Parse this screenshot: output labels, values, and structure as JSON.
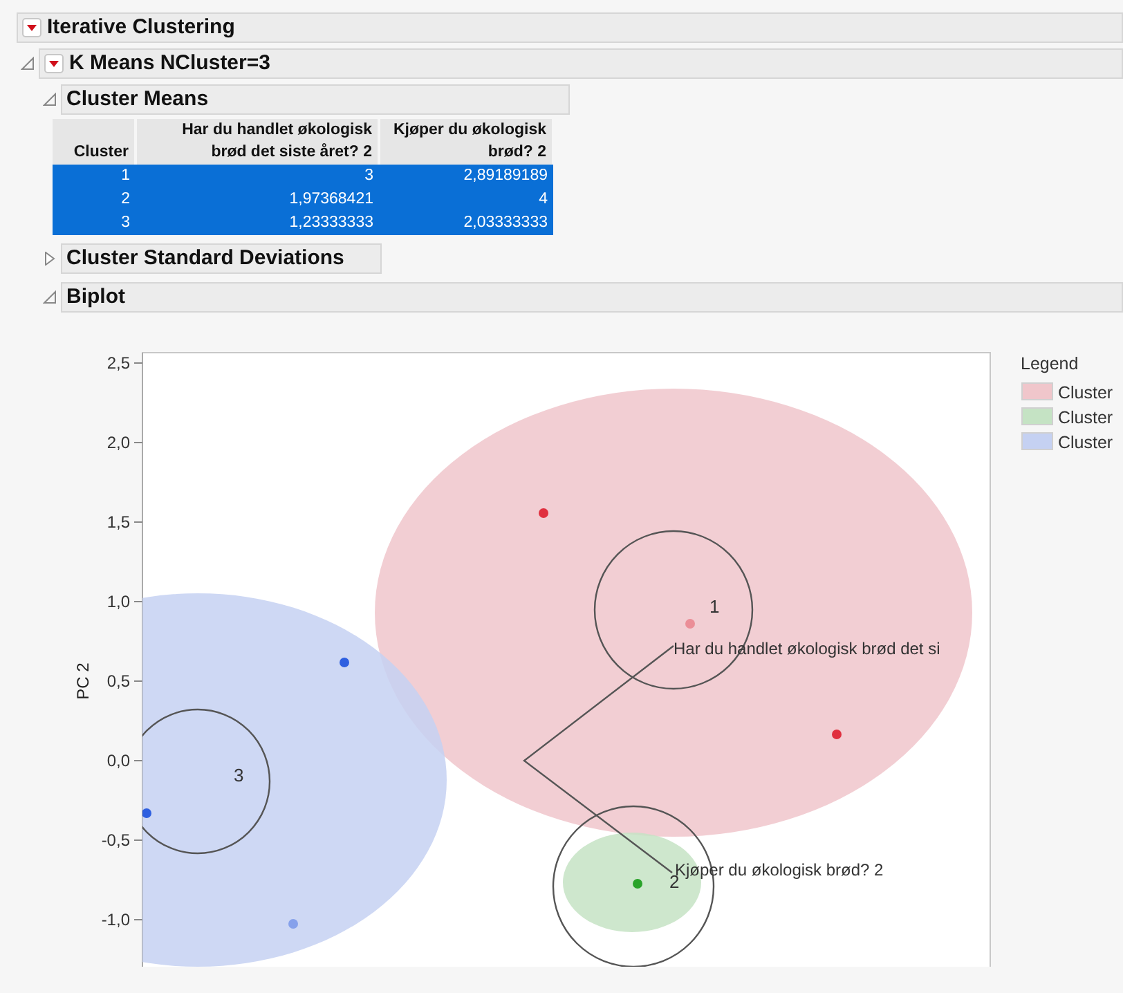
{
  "report": {
    "title": "Iterative Clustering",
    "has_menu": true
  },
  "kmeans": {
    "title": "K Means NCluster=3",
    "expanded": true,
    "has_menu": true
  },
  "cluster_means": {
    "title": "Cluster Means",
    "expanded": true,
    "columns": [
      "Cluster",
      "Har du handlet økologisk brød det siste året? 2",
      "Kjøper du økologisk brød? 2"
    ],
    "rows": [
      {
        "cells": [
          "1",
          "3",
          "2,89189189"
        ],
        "selected": true
      },
      {
        "cells": [
          "2",
          "1,97368421",
          "4"
        ],
        "selected": true
      },
      {
        "cells": [
          "3",
          "1,23333333",
          "2,03333333"
        ],
        "selected": true
      }
    ]
  },
  "cluster_sd": {
    "title": "Cluster Standard Deviations",
    "expanded": false
  },
  "biplot": {
    "title": "Biplot",
    "expanded": true,
    "plot": {
      "axis_title": "PC 2",
      "tick_labels": [
        "2,5",
        "2,0",
        "1,5",
        "1,0",
        "0,5",
        "0,0",
        "-0,5",
        "-1,0"
      ],
      "cluster_labels": [
        "1",
        "2",
        "3"
      ],
      "variable_labels": [
        "Har du handlet økologisk brød det si",
        "Kjøper du økologisk brød? 2"
      ]
    },
    "legend": {
      "title": "Legend",
      "items": [
        {
          "label": "Cluster",
          "color": "#f0c6cb"
        },
        {
          "label": "Cluster",
          "color": "#c5e3c4"
        },
        {
          "label": "Cluster",
          "color": "#c5d1f2"
        }
      ]
    }
  }
}
